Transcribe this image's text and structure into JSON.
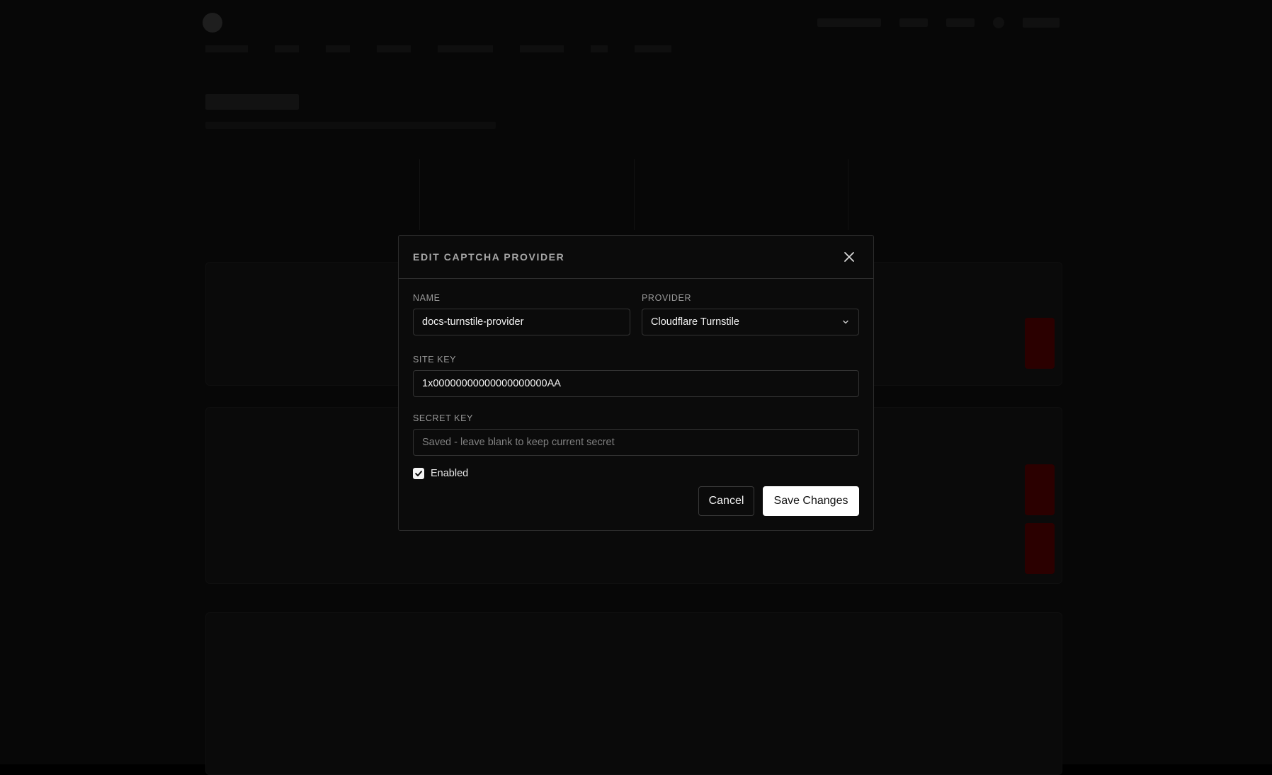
{
  "modal": {
    "title": "EDIT CAPTCHA PROVIDER",
    "name_label": "NAME",
    "name_value": "docs-turnstile-provider",
    "provider_label": "PROVIDER",
    "provider_value": "Cloudflare Turnstile",
    "site_key_label": "SITE KEY",
    "site_key_value": "1x00000000000000000000AA",
    "secret_key_label": "SECRET KEY",
    "secret_key_placeholder": "Saved - leave blank to keep current secret",
    "secret_key_value": "",
    "enabled_label": "Enabled",
    "enabled": true,
    "cancel_label": "Cancel",
    "save_label": "Save Changes"
  },
  "icons": {
    "close": "close-icon",
    "chevron": "chevron-down-icon",
    "check": "check-icon"
  },
  "colors": {
    "backdrop": "#000000",
    "modal_bg": "#0b0b0b",
    "border": "#2d2d2d",
    "primary_button_bg": "#ffffff",
    "text": "#f2f2f2",
    "muted": "#9a9a9a"
  }
}
